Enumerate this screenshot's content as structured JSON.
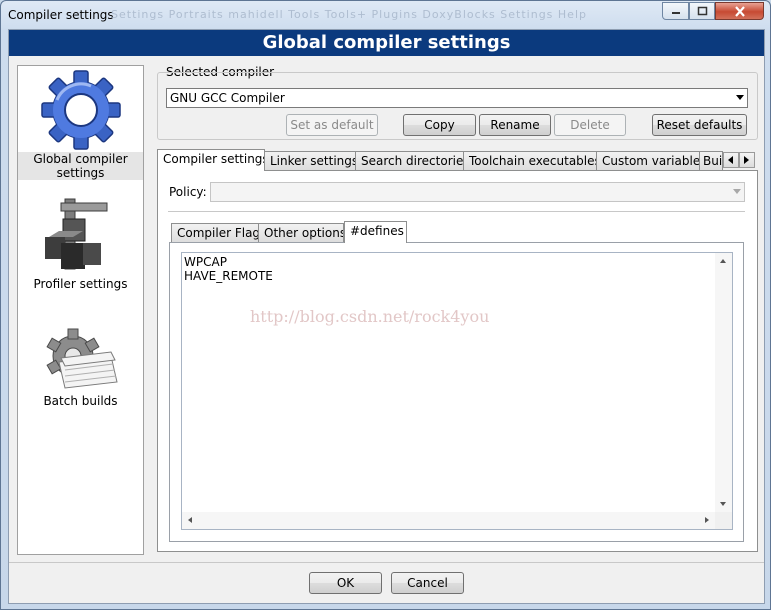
{
  "window": {
    "title": "Compiler settings",
    "background_menu_ghost": "Settings   Portraits   mahidell   Tools   Tools+   Plugins   DoxyBlocks   Settings   Help"
  },
  "banner": {
    "title": "Global compiler settings"
  },
  "sidebar": {
    "items": [
      {
        "label": "Global compiler settings",
        "icon": "gear-icon",
        "selected": true
      },
      {
        "label": "Profiler settings",
        "icon": "caliper-icon",
        "selected": false
      },
      {
        "label": "Batch builds",
        "icon": "batch-gear-icon",
        "selected": false
      }
    ]
  },
  "selected_compiler": {
    "group_label": "Selected compiler",
    "value": "GNU GCC Compiler"
  },
  "compiler_buttons": {
    "set_as_default": "Set as default",
    "copy": "Copy",
    "rename": "Rename",
    "delete": "Delete",
    "reset_defaults": "Reset defaults"
  },
  "main_tabs": [
    {
      "label": "Compiler settings",
      "active": true
    },
    {
      "label": "Linker settings",
      "active": false
    },
    {
      "label": "Search directories",
      "active": false
    },
    {
      "label": "Toolchain executables",
      "active": false
    },
    {
      "label": "Custom variables",
      "active": false
    },
    {
      "label": "Bui",
      "active": false
    }
  ],
  "policy": {
    "label": "Policy:",
    "value": ""
  },
  "sub_tabs": [
    {
      "label": "Compiler Flags",
      "active": false
    },
    {
      "label": "Other options",
      "active": false
    },
    {
      "label": "#defines",
      "active": true
    }
  ],
  "defines": {
    "text": "WPCAP\nHAVE_REMOTE"
  },
  "watermark": "http://blog.csdn.net/rock4you",
  "footer": {
    "ok": "OK",
    "cancel": "Cancel"
  },
  "colors": {
    "banner": "#0b3a7e",
    "gear_blue": "#3a63c4",
    "close_red": "#c74a33"
  }
}
